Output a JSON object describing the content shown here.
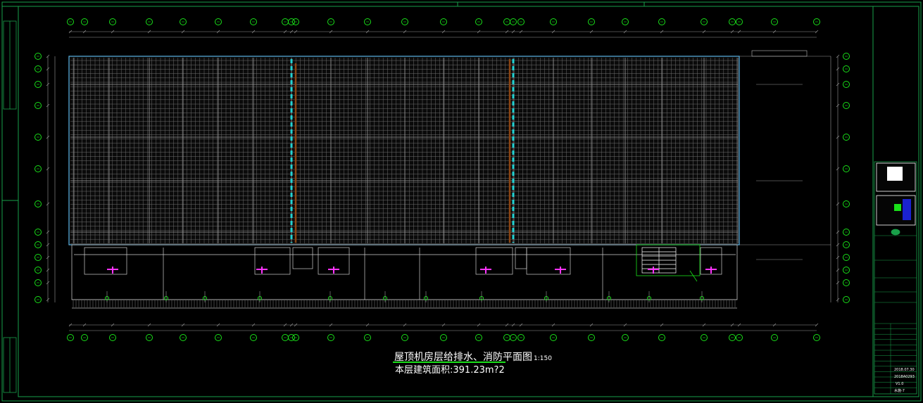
{
  "drawing": {
    "title": "屋顶机房层给排水、消防平面图",
    "scale": "1:150",
    "floor_area_label": "本层建筑面积:",
    "floor_area_value": "391.23m?2"
  },
  "colors": {
    "background": "#000000",
    "frame": "#19a04a",
    "axis_bubble": "#19e019",
    "grid": "#7a7a7a",
    "roof_outline": "#5ab4e6",
    "dashed_pipe": "#22d3d3",
    "brown_line": "#8b4513",
    "fixture": "#ff33ff"
  },
  "title_block": {
    "rows": [
      "",
      "",
      "",
      "",
      "",
      "",
      "",
      "",
      "",
      "",
      "",
      "",
      ""
    ],
    "bottom_lines": [
      "2018.07.30",
      "2018A0293",
      "V1.0",
      "水施-7"
    ]
  },
  "icons": [
    "grid-axis-bubble-icon",
    "fire-hydrant-icon",
    "stair-icon",
    "drain-icon"
  ]
}
